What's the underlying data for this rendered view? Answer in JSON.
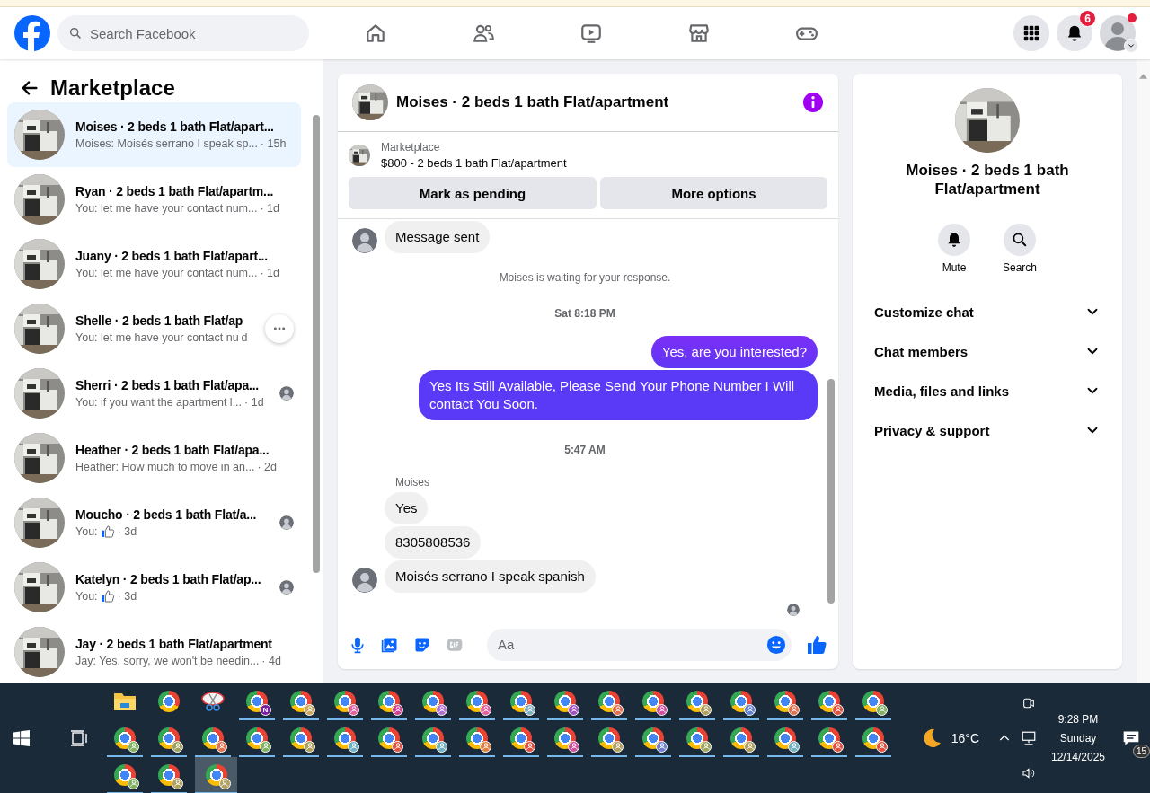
{
  "header": {
    "search": {
      "placeholder": "Search Facebook"
    },
    "nav": [
      {
        "kind": "home"
      },
      {
        "kind": "friends"
      },
      {
        "kind": "watch"
      },
      {
        "kind": "marketplace"
      },
      {
        "kind": "gaming"
      }
    ],
    "notifications": {
      "badge": "6"
    },
    "account": {
      "alert": true
    }
  },
  "sidebar": {
    "title": "Marketplace",
    "conversations": [
      {
        "title": "Moises · 2 beds 1 bath Flat/apart...",
        "preview": "Moises: Moisés serrano I speak sp...",
        "kind": "text",
        "time": "· 15h",
        "selected": true,
        "seen": false,
        "options_shown": false
      },
      {
        "title": "Ryan · 2 beds 1 bath Flat/apartm...",
        "preview": "You: let me have your contact num...",
        "kind": "text",
        "time": "· 1d",
        "selected": false,
        "seen": false,
        "options_shown": false
      },
      {
        "title": "Juany · 2 beds 1 bath Flat/apart...",
        "preview": "You: let me have your contact num...",
        "kind": "text",
        "time": "· 1d",
        "selected": false,
        "seen": false,
        "options_shown": false
      },
      {
        "title": "Shelle · 2 beds 1 bath Flat/ap",
        "preview": "You: let me have your contact nu",
        "kind": "text",
        "time": "d",
        "selected": false,
        "seen": false,
        "options_shown": true
      },
      {
        "title": "Sherri · 2 beds 1 bath Flat/apa...",
        "preview": "You: if you want the apartment l...",
        "kind": "text",
        "time": "· 1d",
        "selected": false,
        "seen": true,
        "options_shown": false
      },
      {
        "title": "Heather · 2 beds 1 bath Flat/apa...",
        "preview": "Heather: How much to move in an...",
        "kind": "text",
        "time": "· 2d",
        "selected": false,
        "seen": false,
        "options_shown": false
      },
      {
        "title": "Moucho · 2 beds 1 bath Flat/a...",
        "preview": "You:",
        "kind": "like",
        "time": "· 3d",
        "selected": false,
        "seen": true,
        "options_shown": false
      },
      {
        "title": "Katelyn · 2 beds 1 bath Flat/ap...",
        "preview": "You:",
        "kind": "like",
        "time": "· 3d",
        "selected": false,
        "seen": true,
        "options_shown": false
      },
      {
        "title": "Jay · 2 beds 1 bath Flat/apartment",
        "preview": "Jay: Yes. sorry, we won't be needin...",
        "kind": "text",
        "time": "· 4d",
        "selected": false,
        "seen": false,
        "options_shown": false
      }
    ]
  },
  "chat": {
    "title": "Moises · 2 beds 1 bath Flat/apartment",
    "listing": {
      "source": "Marketplace",
      "summary": "$800 - 2 beds 1 bath Flat/apartment",
      "buttons": [
        "Mark as pending",
        "More options"
      ]
    },
    "messages": [
      {
        "kind": "incoming",
        "text": "Message sent",
        "avatar": true
      },
      {
        "kind": "status",
        "text": "Moises is waiting for your response."
      },
      {
        "kind": "time",
        "text": "Sat 8:18 PM"
      },
      {
        "kind": "outgoing",
        "text": "Yes, are you interested?"
      },
      {
        "kind": "outgoing",
        "text": "Yes Its Still Available, Please Send Your Phone Number I Will contact You Soon."
      },
      {
        "kind": "time",
        "text": "5:47 AM"
      },
      {
        "kind": "sender",
        "text": "Moises"
      },
      {
        "kind": "incoming",
        "text": "Yes",
        "avatar": false
      },
      {
        "kind": "incoming",
        "text": "8305808536",
        "avatar": false
      },
      {
        "kind": "incoming",
        "text": "Moisés serrano I speak spanish",
        "avatar": true
      }
    ],
    "seen": true,
    "composer": {
      "placeholder": "Aa"
    }
  },
  "details": {
    "title": "Moises · 2 beds 1 bath Flat/apartment",
    "actions": [
      {
        "kind": "mute",
        "label": "Mute"
      },
      {
        "kind": "search",
        "label": "Search"
      }
    ],
    "sections": [
      {
        "label": "Customize chat",
        "expanded": false
      },
      {
        "label": "Chat members",
        "expanded": false
      },
      {
        "label": "Media, files and links",
        "expanded": false
      },
      {
        "label": "Privacy & support",
        "expanded": false
      }
    ]
  },
  "taskbar": {
    "apps": [
      {
        "kind": "folder",
        "running": false,
        "selected": false
      },
      {
        "kind": "chrome",
        "running": false,
        "selected": false
      },
      {
        "kind": "snip",
        "running": false,
        "selected": false
      },
      {
        "kind": "chrome",
        "color": "#7b1fa2",
        "badge_text": "N",
        "running": true,
        "selected": false
      },
      {
        "kind": "chrome",
        "color": "#c8a860",
        "running": true,
        "selected": false
      },
      {
        "kind": "chrome",
        "color": "#e060a0",
        "running": true,
        "selected": false
      },
      {
        "kind": "chrome",
        "color": "#d04090",
        "running": true,
        "selected": false
      },
      {
        "kind": "chrome",
        "color": "#b070d0",
        "running": true,
        "selected": false
      },
      {
        "kind": "chrome",
        "color": "#e060a0",
        "running": true,
        "selected": false
      },
      {
        "kind": "chrome",
        "color": "#80b0c0",
        "running": true,
        "selected": false
      },
      {
        "kind": "chrome",
        "color": "#a050c0",
        "running": true,
        "selected": false
      },
      {
        "kind": "chrome",
        "color": "#e07050",
        "running": true,
        "selected": false
      },
      {
        "kind": "chrome",
        "color": "#d050a0",
        "running": true,
        "selected": false
      },
      {
        "kind": "chrome",
        "color": "#b0a060",
        "running": true,
        "selected": false
      },
      {
        "kind": "chrome",
        "color": "#6080d0",
        "running": true,
        "selected": false
      },
      {
        "kind": "chrome",
        "color": "#e07050",
        "running": true,
        "selected": false
      },
      {
        "kind": "chrome",
        "color": "#e05040",
        "running": true,
        "selected": false
      },
      {
        "kind": "chrome",
        "color": "#80b060",
        "running": true,
        "selected": false
      },
      {
        "kind": "chrome",
        "color": "#80b060",
        "running": true,
        "selected": false
      },
      {
        "kind": "chrome",
        "color": "#a0a060",
        "running": true,
        "selected": false
      },
      {
        "kind": "chrome",
        "color": "#e07050",
        "running": true,
        "selected": false
      },
      {
        "kind": "chrome",
        "color": "#80b060",
        "running": true,
        "selected": false
      },
      {
        "kind": "chrome",
        "color": "#b0a060",
        "running": true,
        "selected": false
      },
      {
        "kind": "chrome",
        "color": "#70b0c0",
        "running": true,
        "selected": false
      },
      {
        "kind": "chrome",
        "color": "#e05040",
        "running": true,
        "selected": false
      },
      {
        "kind": "chrome",
        "color": "#70b0c0",
        "running": true,
        "selected": false
      },
      {
        "kind": "chrome",
        "color": "#e08040",
        "running": true,
        "selected": false
      },
      {
        "kind": "chrome",
        "color": "#e05040",
        "running": true,
        "selected": false
      },
      {
        "kind": "chrome",
        "color": "#d050a0",
        "running": true,
        "selected": false
      },
      {
        "kind": "chrome",
        "color": "#b0a060",
        "running": true,
        "selected": false
      },
      {
        "kind": "chrome",
        "color": "#7080d0",
        "running": true,
        "selected": false
      },
      {
        "kind": "chrome",
        "color": "#a0a860",
        "running": true,
        "selected": false
      },
      {
        "kind": "chrome",
        "color": "#b0a060",
        "running": true,
        "selected": false
      },
      {
        "kind": "chrome",
        "color": "#70b0c0",
        "running": true,
        "selected": false
      },
      {
        "kind": "chrome",
        "color": "#e05040",
        "running": true,
        "selected": false
      },
      {
        "kind": "chrome",
        "color": "#e05040",
        "running": true,
        "selected": false
      },
      {
        "kind": "chrome",
        "color": "#80b060",
        "running": true,
        "selected": false
      },
      {
        "kind": "chrome",
        "color": "#b0a060",
        "running": true,
        "selected": false
      },
      {
        "kind": "chrome",
        "color": "#b0a060",
        "running": true,
        "selected": true
      }
    ],
    "weather": {
      "temperature": "16°C"
    },
    "clock": {
      "time": "9:28 PM",
      "day": "Sunday",
      "date": "12/14/2025"
    },
    "notifications": {
      "badge": "15"
    }
  }
}
